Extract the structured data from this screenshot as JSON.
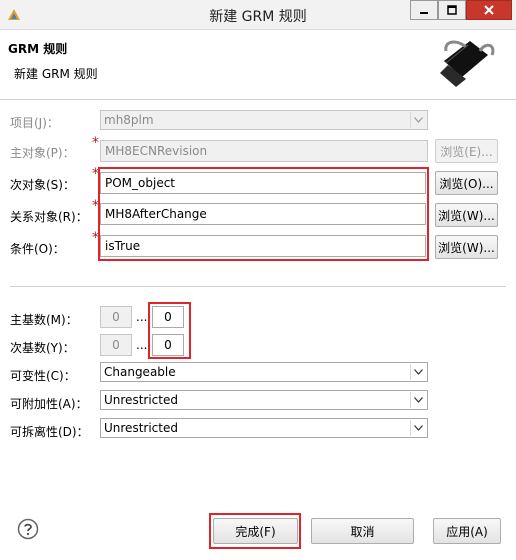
{
  "window": {
    "title": "新建 GRM 规则"
  },
  "header": {
    "title": "GRM 规则",
    "subtitle": "新建 GRM 规则"
  },
  "form": {
    "project": {
      "label": "项目(J)：",
      "value": "mh8plm"
    },
    "primary": {
      "label": "主对象(P)：",
      "value": "MH8ECNRevision",
      "browse": "浏览(E)..."
    },
    "secondary": {
      "label": "次对象(S)：",
      "value": "POM_object",
      "browse": "浏览(O)..."
    },
    "relation": {
      "label": "关系对象(R)：",
      "value": "MH8AfterChange",
      "browse": "浏览(W)..."
    },
    "condition": {
      "label": "条件(O)：",
      "value": "isTrue",
      "browse": "浏览(W)..."
    },
    "required_mark": "*"
  },
  "cardinality": {
    "primary": {
      "label": "主基数(M)：",
      "min": "0",
      "sep": "...",
      "max": "0"
    },
    "secondary": {
      "label": "次基数(Y)：",
      "min": "0",
      "sep": "...",
      "max": "0"
    },
    "changeability": {
      "label": "可变性(C)：",
      "value": "Changeable"
    },
    "attachability": {
      "label": "可附加性(A)：",
      "value": "Unrestricted"
    },
    "detachability": {
      "label": "可拆离性(D)：",
      "value": "Unrestricted"
    }
  },
  "footer": {
    "finish": "完成(F)",
    "cancel": "取消",
    "apply": "应用(A)"
  },
  "colors": {
    "highlight": "#e0242b",
    "required": "#b22222"
  }
}
